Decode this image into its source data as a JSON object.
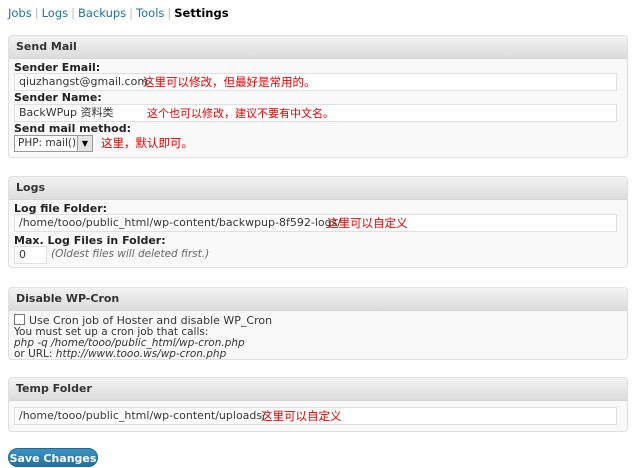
{
  "subnav": {
    "items": [
      "Jobs",
      "Logs",
      "Backups",
      "Tools",
      "Settings"
    ],
    "separator": "|",
    "active": "Settings"
  },
  "send_mail": {
    "title": "Send Mail",
    "sender_email_label": "Sender Email:",
    "sender_email_value": "qiuzhangst@gmail.com",
    "sender_email_note": "这里可以修改，但最好是常用的。",
    "sender_name_label": "Sender Name:",
    "sender_name_value": "BackWPup 资料类",
    "sender_name_note": "这个也可以修改，建议不要有中文名。",
    "method_label": "Send mail method:",
    "method_value": "PHP: mail()",
    "method_note": "这里，默认即可。"
  },
  "logs": {
    "title": "Logs",
    "folder_label": "Log file Folder:",
    "folder_value": "/home/tooo/public_html/wp-content/backwpup-8f592-logs/",
    "folder_note": "这里可以自定义",
    "max_label": "Max. Log Files in Folder:",
    "max_value": "0",
    "max_hint": "(Oldest files will deleted first.)"
  },
  "cron": {
    "title": "Disable WP-Cron",
    "checkbox_label": "Use Cron job of Hoster and disable WP_Cron",
    "line1": "You must set up a cron job that calls:",
    "line2": "php -q /home/tooo/public_html/wp-cron.php",
    "line3_prefix": "or URL: ",
    "line3_url": "http://www.tooo.ws/wp-cron.php"
  },
  "temp": {
    "title": "Temp Folder",
    "folder_value": "/home/tooo/public_html/wp-content/uploads/",
    "folder_note": "这里可以自定义"
  },
  "save_button": "Save Changes",
  "colors": {
    "accent": "#21759b",
    "note": "#e60000",
    "button": "#2a7cab"
  }
}
